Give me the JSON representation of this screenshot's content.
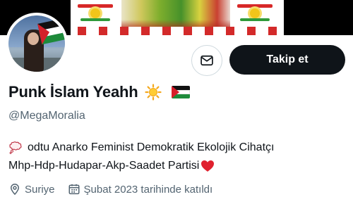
{
  "profile": {
    "display_name": "Punk İslam Yeahh",
    "name_emojis": [
      "sun-emoji",
      "palestine-flag-emoji"
    ],
    "handle": "@MegaMoralia",
    "bio_line_1": "odtu Anarko Feminist Demokratik Ekolojik Cihatçı",
    "bio_line_2": "Mhp-Hdp-Hudapar-Akp-Saadet Partisi",
    "location": "Suriye",
    "joined": "Şubat 2023 tarihinde katıldı"
  },
  "actions": {
    "follow_label": "Takip et",
    "message_icon": "envelope-icon"
  },
  "icons": {
    "location": "location-pin-icon",
    "calendar": "calendar-icon",
    "bio_prefix": "thought-bubble-emoji",
    "bio_suffix": "red-heart-emoji"
  },
  "colors": {
    "follow_bg": "#0f1419",
    "secondary_text": "#536471",
    "border": "#cfd9de"
  }
}
